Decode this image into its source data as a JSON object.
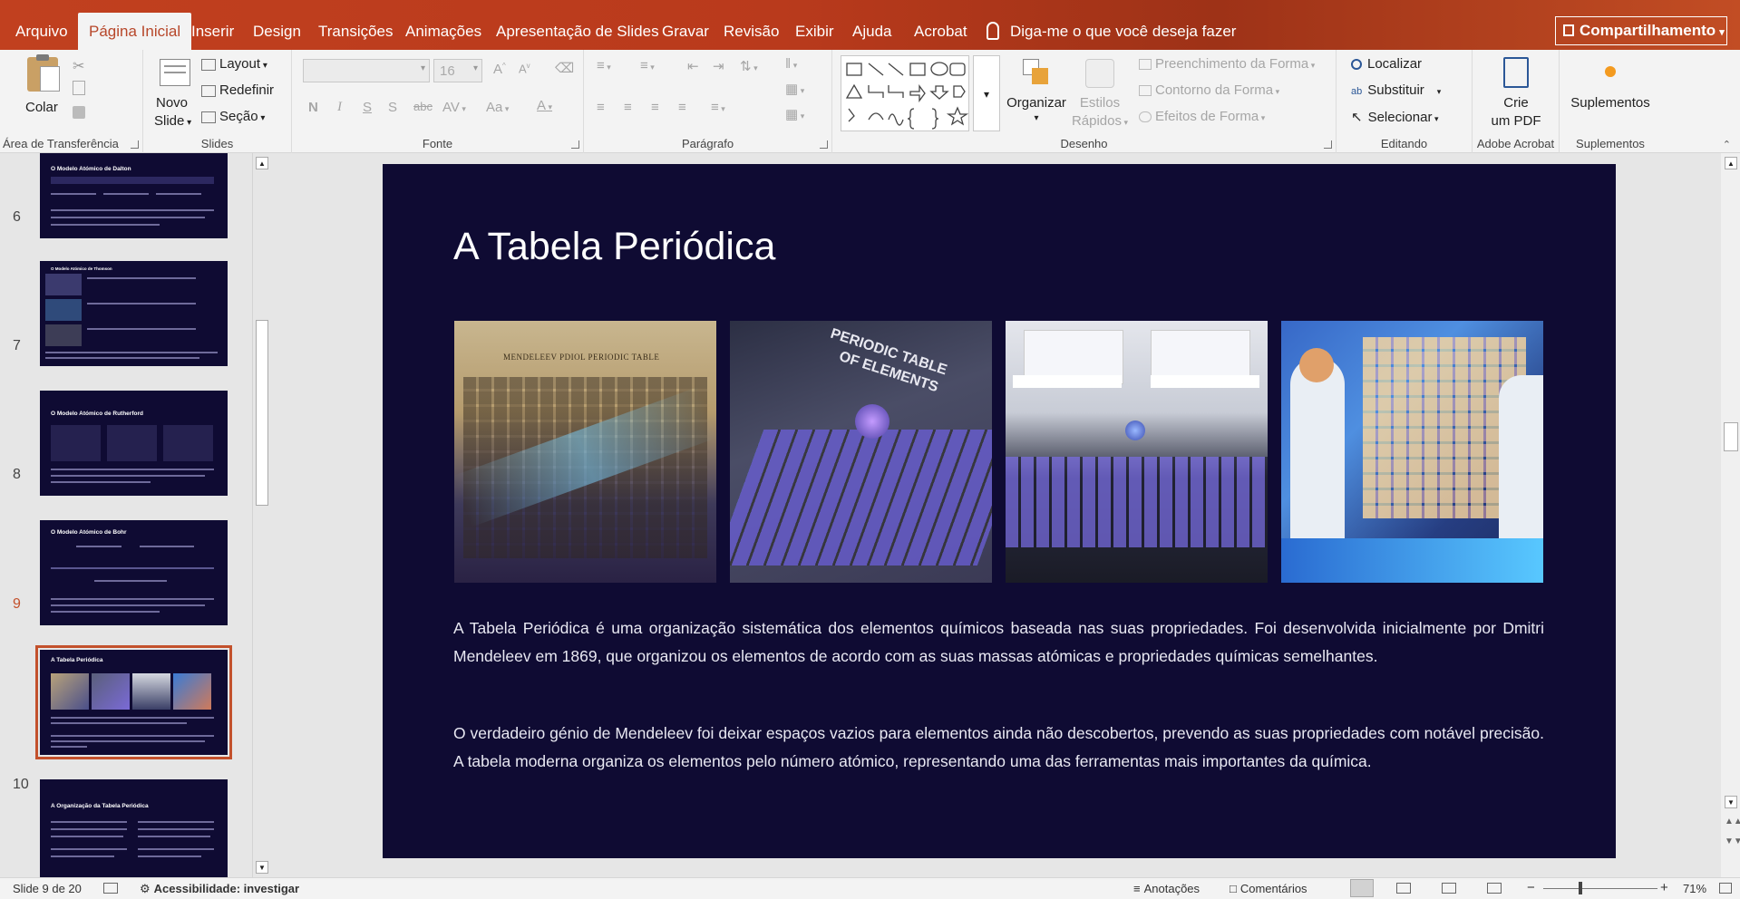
{
  "menu": {
    "tabs": [
      "Arquivo",
      "Página Inicial",
      "Inserir",
      "Design",
      "Transições",
      "Animações",
      "Apresentação de Slides",
      "Gravar",
      "Revisão",
      "Exibir",
      "Ajuda",
      "Acrobat"
    ],
    "tell_me": "Diga-me o que você deseja fazer",
    "share": "Compartilhamento"
  },
  "ribbon": {
    "clipboard": {
      "paste": "Colar",
      "label": "Área de Transferência"
    },
    "slides": {
      "new_slide_1": "Novo",
      "new_slide_2": "Slide",
      "layout": "Layout",
      "reset": "Redefinir",
      "section": "Seção",
      "label": "Slides"
    },
    "font": {
      "name": "",
      "size": "16",
      "label": "Fonte"
    },
    "paragraph": {
      "label": "Parágrafo"
    },
    "drawing": {
      "arrange": "Organizar",
      "quick_styles_1": "Estilos",
      "quick_styles_2": "Rápidos",
      "shape_fill": "Preenchimento da Forma",
      "shape_outline": "Contorno da Forma",
      "shape_effects": "Efeitos de Forma",
      "label": "Desenho"
    },
    "editing": {
      "find": "Localizar",
      "replace": "Substituir",
      "select": "Selecionar",
      "label": "Editando"
    },
    "acrobat": {
      "create_1": "Crie",
      "create_2": "um PDF",
      "label": "Adobe Acrobat"
    },
    "addins": {
      "addins": "Suplementos",
      "label": "Suplementos"
    }
  },
  "thumbnails": [
    {
      "num": "",
      "title": "O Modelo Atómico de Dalton"
    },
    {
      "num": "6",
      "title": "O Modelo Atómico de Thomson"
    },
    {
      "num": "7",
      "title": "O Modelo Atómico de Rutherford"
    },
    {
      "num": "8",
      "title": "O Modelo Atómico de Bohr"
    },
    {
      "num": "9",
      "title": "A Tabela Periódica"
    },
    {
      "num": "10",
      "title": "A Organização da Tabela Periódica"
    }
  ],
  "slide": {
    "title": "A Tabela Periódica",
    "image_labels": [
      "MENDELEEV PDIOL PERIODIC TABLE",
      "PERIODIC TABLE",
      "OF ELEMENTS"
    ],
    "paragraph1": "A Tabela Periódica é uma organização sistemática dos elementos químicos baseada nas suas propriedades. Foi desenvolvida inicialmente por Dmitri Mendeleev em 1869, que organizou os elementos de acordo com as suas massas atómicas e propriedades químicas semelhantes.",
    "paragraph2": "O verdadeiro génio de Mendeleev foi deixar espaços vazios para elementos ainda não descobertos, prevendo as suas propriedades com notável precisão. A tabela moderna organiza os elementos pelo número atómico, representando uma das ferramentas mais importantes da química."
  },
  "status": {
    "slide_info": "Slide 9 de 20",
    "accessibility": "Acessibilidade: investigar",
    "notes": "Anotações",
    "comments": "Comentários",
    "zoom": "71%"
  },
  "colors": {
    "accent": "#b7472a",
    "slide_bg": "#0f0b33",
    "selected_thumb": "#c3512c"
  }
}
